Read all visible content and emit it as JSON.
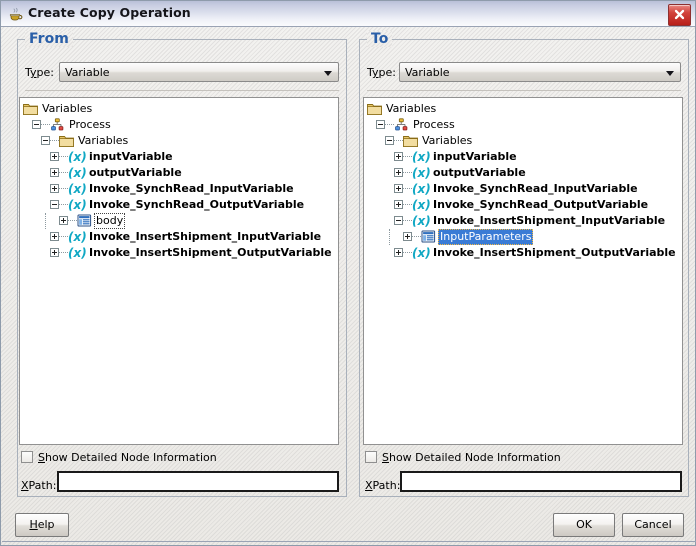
{
  "window": {
    "title": "Create Copy Operation",
    "title_icon": "java-coffee-cup-icon",
    "close_label": "×"
  },
  "from_panel": {
    "legend": "From",
    "type_label_pre": "T",
    "type_label_accel": "y",
    "type_label_post": "pe:",
    "type_value": "Variable",
    "type_options": [
      "Variable"
    ],
    "checkbox_label_pre": "",
    "checkbox_accel": "S",
    "checkbox_label_post": "how Detailed Node Information",
    "checkbox_checked": false,
    "xpath_label_accel": "X",
    "xpath_label_post": "Path:",
    "xpath_value": "",
    "xpath_placeholder": "",
    "tree": [
      {
        "depth": 0,
        "toggle": "none",
        "icon": "folder-icon",
        "label": "Variables",
        "bold": false,
        "state": "normal"
      },
      {
        "depth": 1,
        "toggle": "expanded",
        "icon": "process-icon",
        "label": "Process",
        "bold": false,
        "state": "normal"
      },
      {
        "depth": 2,
        "toggle": "expanded",
        "icon": "folder-icon",
        "label": "Variables",
        "bold": false,
        "state": "normal"
      },
      {
        "depth": 3,
        "toggle": "collapsed",
        "icon": "variable-icon",
        "label": "inputVariable",
        "bold": true,
        "state": "normal"
      },
      {
        "depth": 3,
        "toggle": "collapsed",
        "icon": "variable-icon",
        "label": "outputVariable",
        "bold": true,
        "state": "normal"
      },
      {
        "depth": 3,
        "toggle": "collapsed",
        "icon": "variable-icon",
        "label": "Invoke_SynchRead_InputVariable",
        "bold": true,
        "state": "normal"
      },
      {
        "depth": 3,
        "toggle": "expanded",
        "icon": "variable-icon",
        "label": "Invoke_SynchRead_OutputVariable",
        "bold": true,
        "state": "normal"
      },
      {
        "depth": 4,
        "toggle": "collapsed",
        "icon": "element-icon",
        "label": "body",
        "bold": false,
        "state": "focused"
      },
      {
        "depth": 3,
        "toggle": "collapsed",
        "icon": "variable-icon",
        "label": "Invoke_InsertShipment_InputVariable",
        "bold": true,
        "state": "normal"
      },
      {
        "depth": 3,
        "toggle": "collapsed",
        "icon": "variable-icon",
        "label": "Invoke_InsertShipment_OutputVariable",
        "bold": true,
        "state": "normal"
      }
    ]
  },
  "to_panel": {
    "legend": "To",
    "type_label_pre": "T",
    "type_label_accel": "y",
    "type_label_post": "pe:",
    "type_value": "Variable",
    "type_options": [
      "Variable"
    ],
    "checkbox_accel": "S",
    "checkbox_label_post": "how Detailed Node Information",
    "checkbox_checked": false,
    "xpath_label_accel": "X",
    "xpath_label_post": "Path:",
    "xpath_value": "",
    "xpath_placeholder": "",
    "tree": [
      {
        "depth": 0,
        "toggle": "none",
        "icon": "folder-icon",
        "label": "Variables",
        "bold": false,
        "state": "normal"
      },
      {
        "depth": 1,
        "toggle": "expanded",
        "icon": "process-icon",
        "label": "Process",
        "bold": false,
        "state": "normal"
      },
      {
        "depth": 2,
        "toggle": "expanded",
        "icon": "folder-icon",
        "label": "Variables",
        "bold": false,
        "state": "normal"
      },
      {
        "depth": 3,
        "toggle": "collapsed",
        "icon": "variable-icon",
        "label": "inputVariable",
        "bold": true,
        "state": "normal"
      },
      {
        "depth": 3,
        "toggle": "collapsed",
        "icon": "variable-icon",
        "label": "outputVariable",
        "bold": true,
        "state": "normal"
      },
      {
        "depth": 3,
        "toggle": "collapsed",
        "icon": "variable-icon",
        "label": "Invoke_SynchRead_InputVariable",
        "bold": true,
        "state": "normal"
      },
      {
        "depth": 3,
        "toggle": "collapsed",
        "icon": "variable-icon",
        "label": "Invoke_SynchRead_OutputVariable",
        "bold": true,
        "state": "normal"
      },
      {
        "depth": 3,
        "toggle": "expanded",
        "icon": "variable-icon",
        "label": "Invoke_InsertShipment_InputVariable",
        "bold": true,
        "state": "normal"
      },
      {
        "depth": 4,
        "toggle": "collapsed",
        "icon": "element-icon",
        "label": "InputParameters",
        "bold": false,
        "state": "selected"
      },
      {
        "depth": 3,
        "toggle": "collapsed",
        "icon": "variable-icon",
        "label": "Invoke_InsertShipment_OutputVariable",
        "bold": true,
        "state": "normal"
      }
    ]
  },
  "buttons": {
    "help_accel": "H",
    "help_post": "elp",
    "ok": "OK",
    "cancel": "Cancel"
  },
  "colors": {
    "accent_blue": "#2a5fa8",
    "selection_blue": "#3a7bd5",
    "selection_focus_ring": "#f5b944",
    "variable_icon": "#11a8c4",
    "close_red": "#b81f1a",
    "titlebar_top": "#b9c0d8"
  }
}
